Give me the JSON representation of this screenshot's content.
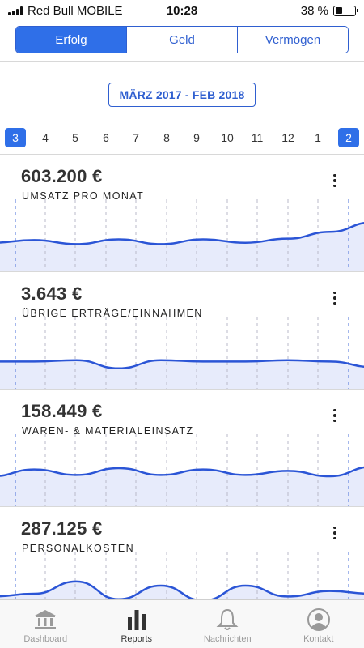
{
  "status_bar": {
    "carrier": "Red Bull MOBILE",
    "time": "10:28",
    "battery_percent_label": "38 %",
    "battery_level": 0.38
  },
  "segments": [
    {
      "label": "Erfolg",
      "active": true
    },
    {
      "label": "Geld",
      "active": false
    },
    {
      "label": "Vermögen",
      "active": false
    }
  ],
  "period": {
    "label": "MÄRZ 2017 - FEB 2018"
  },
  "months": [
    {
      "label": "3",
      "active": true
    },
    {
      "label": "4",
      "active": false
    },
    {
      "label": "5",
      "active": false
    },
    {
      "label": "6",
      "active": false
    },
    {
      "label": "7",
      "active": false
    },
    {
      "label": "8",
      "active": false
    },
    {
      "label": "9",
      "active": false
    },
    {
      "label": "10",
      "active": false
    },
    {
      "label": "11",
      "active": false
    },
    {
      "label": "12",
      "active": false
    },
    {
      "label": "1",
      "active": false
    },
    {
      "label": "2",
      "active": true
    }
  ],
  "cards": [
    {
      "amount": "603.200 €",
      "label": "UMSATZ PRO MONAT",
      "series": [
        42,
        46,
        40,
        47,
        40,
        47,
        42,
        48,
        58,
        72
      ]
    },
    {
      "amount": "3.643 €",
      "label": "ÜBRIGE ERTRÄGE/EINNAHMEN",
      "series": [
        40,
        40,
        42,
        30,
        42,
        40,
        40,
        42,
        40,
        32
      ]
    },
    {
      "amount": "158.449 €",
      "label": "WAREN- & MATERIALEINSATZ",
      "series": [
        44,
        54,
        46,
        56,
        46,
        54,
        46,
        52,
        44,
        58
      ]
    },
    {
      "amount": "287.125 €",
      "label": "PERSONALKOSTEN",
      "series": [
        40,
        44,
        62,
        36,
        56,
        34,
        56,
        40,
        48,
        44
      ]
    }
  ],
  "tabbar": [
    {
      "label": "Dashboard",
      "icon": "bank-icon",
      "active": false
    },
    {
      "label": "Reports",
      "icon": "bar-chart-icon",
      "active": true
    },
    {
      "label": "Nachrichten",
      "icon": "bell-icon",
      "active": false
    },
    {
      "label": "Kontakt",
      "icon": "person-icon",
      "active": false
    }
  ],
  "colors": {
    "accent": "#2f6fe8",
    "line": "#2b55d6",
    "fill": "#e7ebfb"
  }
}
